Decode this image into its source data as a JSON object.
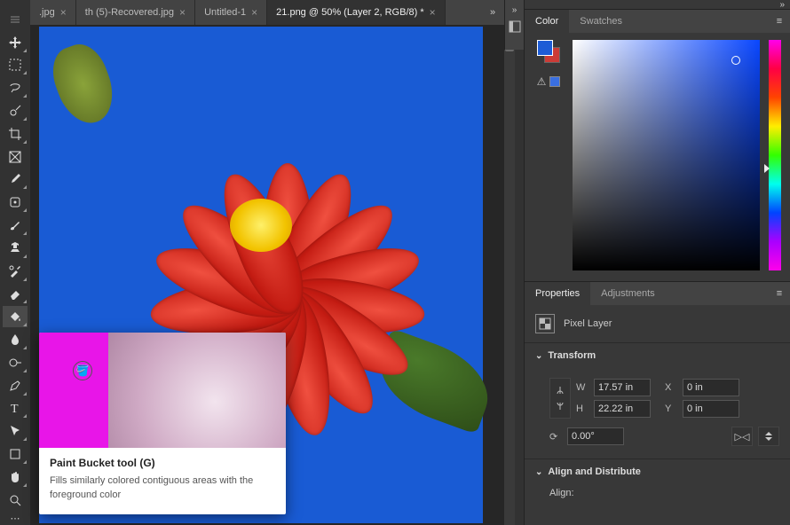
{
  "tabs": [
    {
      "label": ".jpg",
      "active": false
    },
    {
      "label": "th (5)-Recovered.jpg",
      "active": false
    },
    {
      "label": "Untitled-1",
      "active": false
    },
    {
      "label": "21.png @ 50% (Layer 2, RGB/8) *",
      "active": true
    }
  ],
  "tools": [
    {
      "name": "move-tool",
      "corner": false
    },
    {
      "name": "marquee-tool",
      "corner": true
    },
    {
      "name": "lasso-tool",
      "corner": true
    },
    {
      "name": "quick-select-tool",
      "corner": true
    },
    {
      "name": "crop-tool",
      "corner": true
    },
    {
      "name": "frame-tool",
      "corner": false
    },
    {
      "name": "eyedropper-tool",
      "corner": true
    },
    {
      "name": "healing-brush-tool",
      "corner": true
    },
    {
      "name": "brush-tool",
      "corner": true
    },
    {
      "name": "clone-stamp-tool",
      "corner": true
    },
    {
      "name": "history-brush-tool",
      "corner": true
    },
    {
      "name": "eraser-tool",
      "corner": true
    },
    {
      "name": "paint-bucket-tool",
      "corner": true,
      "selected": true
    },
    {
      "name": "blur-tool",
      "corner": true
    },
    {
      "name": "dodge-tool",
      "corner": true
    },
    {
      "name": "pen-tool",
      "corner": true
    },
    {
      "name": "type-tool",
      "corner": true
    },
    {
      "name": "path-select-tool",
      "corner": true
    },
    {
      "name": "shape-tool",
      "corner": true
    },
    {
      "name": "hand-tool",
      "corner": true
    },
    {
      "name": "zoom-tool",
      "corner": false
    }
  ],
  "tooltip": {
    "title": "Paint Bucket tool (G)",
    "desc": "Fills similarly colored contiguous areas with the foreground color"
  },
  "panels": {
    "color": {
      "tabs": [
        "Color",
        "Swatches"
      ],
      "active": "Color",
      "foreground": "#1d5cd6",
      "background": "#cc3b36"
    },
    "properties": {
      "tabs": [
        "Properties",
        "Adjustments"
      ],
      "active": "Properties",
      "layer_type": "Pixel Layer",
      "transform": {
        "title": "Transform",
        "w": "17.57 in",
        "h": "22.22 in",
        "x": "0 in",
        "y": "0 in",
        "angle": "0.00°"
      },
      "align": {
        "title": "Align and Distribute",
        "label": "Align:"
      }
    }
  }
}
